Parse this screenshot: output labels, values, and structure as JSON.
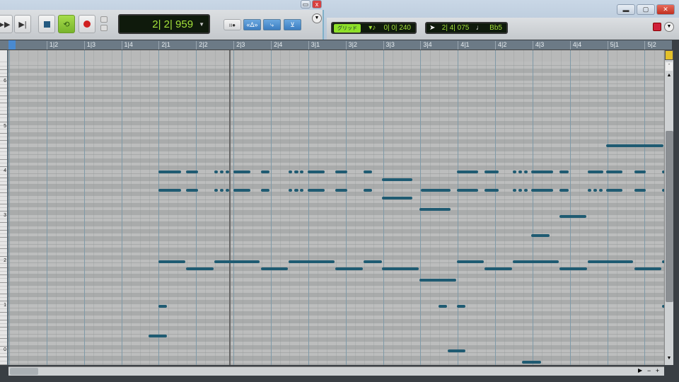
{
  "transport": {
    "time": "2| 2| 959",
    "buttons": [
      "fast-forward",
      "go-to-end",
      "stop",
      "loop",
      "record"
    ]
  },
  "snap": {
    "label": "グリッド",
    "value": "0| 0| 240"
  },
  "cursor_readout": {
    "time": "2| 4| 075",
    "pitch": "Bb5"
  },
  "ruler": [
    "1|2",
    "1|3",
    "1|4",
    "2|1",
    "2|2",
    "2|3",
    "2|4",
    "3|1",
    "3|2",
    "3|3",
    "3|4",
    "4|1",
    "4|2",
    "4|3",
    "4|4",
    "5|1",
    "5|2"
  ],
  "octaves": [
    "6",
    "5",
    "4",
    "3",
    "2",
    "1",
    "0"
  ],
  "colors": {
    "note": "#1f5b72",
    "lcd_text": "#a4e23a",
    "loop_active": "#8cc43c"
  },
  "notes": [
    [
      67,
      15.97,
      1.53
    ],
    [
      60,
      4.0,
      0.6
    ],
    [
      60,
      4.73,
      0.32
    ],
    [
      60,
      5.49,
      0.1
    ],
    [
      60,
      5.64,
      0.1
    ],
    [
      60,
      5.79,
      0.1
    ],
    [
      60,
      6.0,
      0.45
    ],
    [
      60,
      6.74,
      0.22
    ],
    [
      60,
      7.47,
      0.1
    ],
    [
      60,
      7.63,
      0.1
    ],
    [
      60,
      7.78,
      0.1
    ],
    [
      60,
      7.98,
      0.46
    ],
    [
      60,
      8.72,
      0.32
    ],
    [
      60,
      9.48,
      0.23
    ],
    [
      60,
      11.98,
      0.57
    ],
    [
      60,
      12.71,
      0.38
    ],
    [
      60,
      13.47,
      0.1
    ],
    [
      60,
      13.62,
      0.1
    ],
    [
      60,
      13.77,
      0.1
    ],
    [
      60,
      13.96,
      0.59
    ],
    [
      60,
      14.72,
      0.25
    ],
    [
      60,
      15.48,
      0.41
    ],
    [
      60,
      15.97,
      0.43
    ],
    [
      60,
      16.73,
      0.3
    ],
    [
      60,
      17.46,
      0.08
    ],
    [
      58,
      9.97,
      0.82
    ],
    [
      55,
      4.0,
      0.6
    ],
    [
      55,
      4.73,
      0.32
    ],
    [
      55,
      5.49,
      0.1
    ],
    [
      55,
      5.64,
      0.1
    ],
    [
      55,
      5.79,
      0.1
    ],
    [
      55,
      6.0,
      0.45
    ],
    [
      55,
      6.74,
      0.22
    ],
    [
      55,
      7.47,
      0.1
    ],
    [
      55,
      7.63,
      0.1
    ],
    [
      55,
      7.78,
      0.1
    ],
    [
      55,
      7.98,
      0.46
    ],
    [
      55,
      8.72,
      0.32
    ],
    [
      55,
      9.48,
      0.23
    ],
    [
      55,
      11.01,
      0.8
    ],
    [
      55,
      11.98,
      0.57
    ],
    [
      55,
      12.71,
      0.38
    ],
    [
      55,
      13.47,
      0.1
    ],
    [
      55,
      13.62,
      0.1
    ],
    [
      55,
      13.77,
      0.1
    ],
    [
      55,
      13.96,
      0.59
    ],
    [
      55,
      14.72,
      0.25
    ],
    [
      55,
      15.48,
      0.1
    ],
    [
      55,
      15.63,
      0.1
    ],
    [
      55,
      15.78,
      0.1
    ],
    [
      55,
      15.97,
      0.43
    ],
    [
      55,
      16.73,
      0.3
    ],
    [
      55,
      17.46,
      0.08
    ],
    [
      53,
      9.97,
      0.82
    ],
    [
      50,
      10.97,
      0.84
    ],
    [
      48,
      14.72,
      0.72
    ],
    [
      43,
      13.96,
      0.5
    ],
    [
      36,
      4.0,
      0.71
    ],
    [
      36,
      5.49,
      1.21
    ],
    [
      36,
      7.47,
      1.23
    ],
    [
      36,
      9.48,
      0.49
    ],
    [
      36,
      11.98,
      0.72
    ],
    [
      36,
      13.47,
      1.23
    ],
    [
      36,
      15.48,
      1.21
    ],
    [
      36,
      17.46,
      0.08
    ],
    [
      34,
      4.73,
      0.74
    ],
    [
      34,
      6.74,
      0.71
    ],
    [
      34,
      8.72,
      0.74
    ],
    [
      34,
      9.97,
      0.99
    ],
    [
      34,
      12.71,
      0.74
    ],
    [
      34,
      14.72,
      0.74
    ],
    [
      34,
      16.73,
      0.72
    ],
    [
      31,
      10.97,
      0.99
    ],
    [
      24,
      4.0,
      0.22
    ],
    [
      24,
      11.49,
      0.22
    ],
    [
      24,
      11.98,
      0.22
    ],
    [
      24,
      17.46,
      0.08
    ],
    [
      16,
      3.73,
      0.49
    ],
    [
      12,
      11.73,
      0.47
    ],
    [
      9,
      13.72,
      0.51
    ]
  ]
}
